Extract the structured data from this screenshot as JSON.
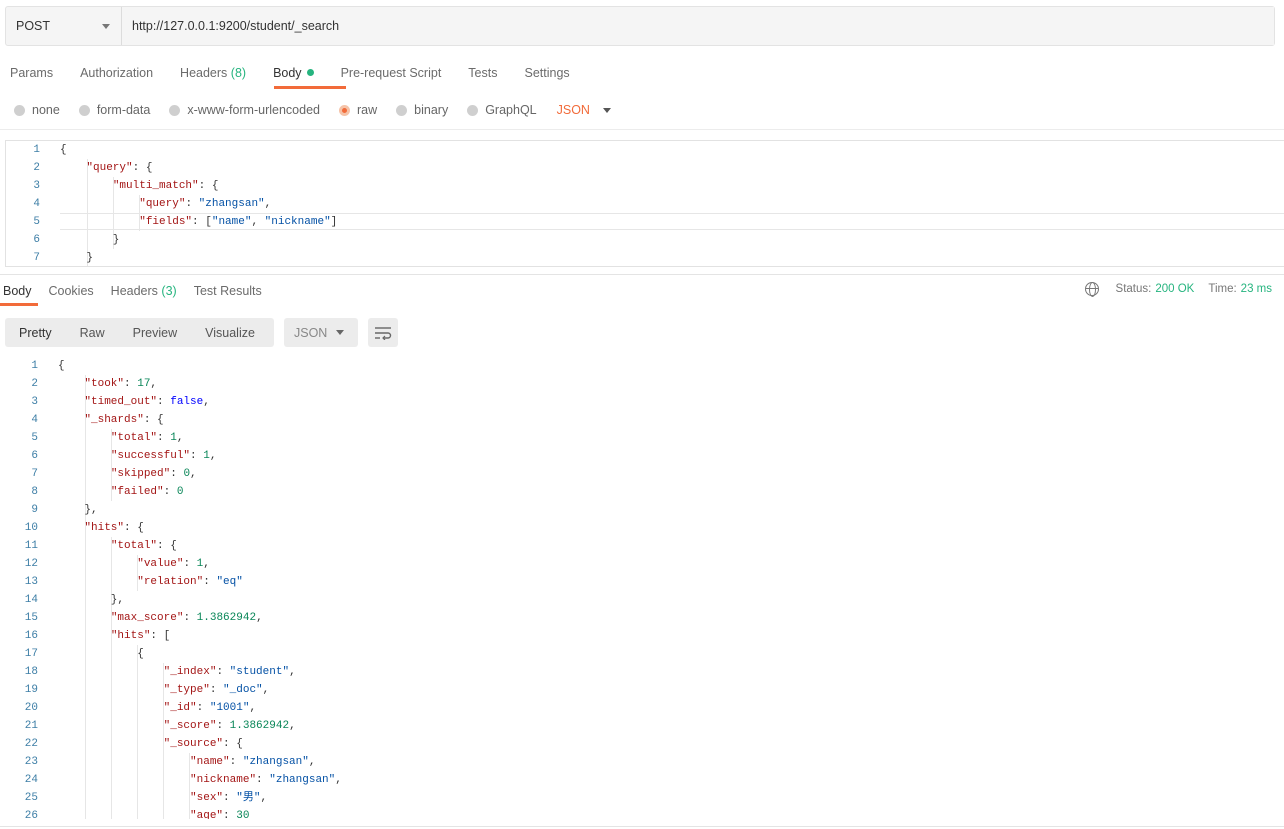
{
  "request": {
    "method": "POST",
    "url": "http://127.0.0.1:9200/student/_search"
  },
  "request_tabs": [
    {
      "label": "Params",
      "count": ""
    },
    {
      "label": "Authorization",
      "count": ""
    },
    {
      "label": "Headers",
      "count": "(8)"
    },
    {
      "label": "Body",
      "count": ""
    },
    {
      "label": "Pre-request Script",
      "count": ""
    },
    {
      "label": "Tests",
      "count": ""
    },
    {
      "label": "Settings",
      "count": ""
    }
  ],
  "active_request_tab": "Body",
  "body_types": [
    "none",
    "form-data",
    "x-www-form-urlencoded",
    "raw",
    "binary",
    "GraphQL"
  ],
  "selected_body_type": "raw",
  "body_language": "JSON",
  "request_body_lines": [
    "{",
    "    \"query\": {",
    "        \"multi_match\": {",
    "            \"query\": \"zhangsan\",",
    "            \"fields\": [\"name\", \"nickname\"]",
    "        }",
    "    }"
  ],
  "response_tabs": [
    {
      "label": "Body",
      "count": ""
    },
    {
      "label": "Cookies",
      "count": ""
    },
    {
      "label": "Headers",
      "count": "(3)"
    },
    {
      "label": "Test Results",
      "count": ""
    }
  ],
  "status": {
    "label": "Status:",
    "value": "200 OK"
  },
  "time": {
    "label": "Time:",
    "value": "23 ms"
  },
  "view_modes": [
    "Pretty",
    "Raw",
    "Preview",
    "Visualize"
  ],
  "active_view_mode": "Pretty",
  "response_format": "JSON",
  "response_body_lines": [
    "{",
    "    \"took\": 17,",
    "    \"timed_out\": false,",
    "    \"_shards\": {",
    "        \"total\": 1,",
    "        \"successful\": 1,",
    "        \"skipped\": 0,",
    "        \"failed\": 0",
    "    },",
    "    \"hits\": {",
    "        \"total\": {",
    "            \"value\": 1,",
    "            \"relation\": \"eq\"",
    "        },",
    "        \"max_score\": 1.3862942,",
    "        \"hits\": [",
    "            {",
    "                \"_index\": \"student\",",
    "                \"_type\": \"_doc\",",
    "                \"_id\": \"1001\",",
    "                \"_score\": 1.3862942,",
    "                \"_source\": {",
    "                    \"name\": \"zhangsan\",",
    "                    \"nickname\": \"zhangsan\",",
    "                    \"sex\": \"男\",",
    "                    \"age\": 30"
  ],
  "colors": {
    "accent": "#f26b3a",
    "green": "#26b47f",
    "line_number": "#3d7ea6",
    "json_key": "#a31515",
    "json_string": "#0451a5",
    "json_number": "#098658",
    "json_boolean": "#0000ff"
  }
}
